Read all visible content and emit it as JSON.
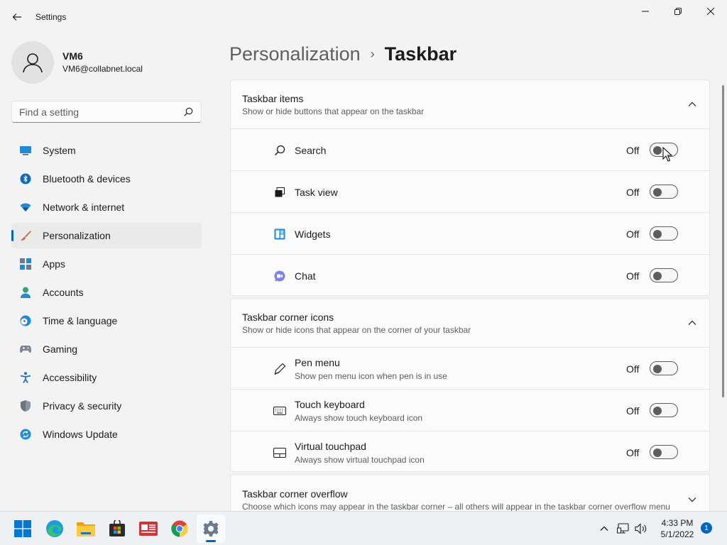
{
  "window": {
    "title": "Settings"
  },
  "profile": {
    "name": "VM6",
    "email": "VM6@collabnet.local"
  },
  "search": {
    "placeholder": "Find a setting"
  },
  "nav": {
    "items": [
      {
        "label": "System",
        "icon": "system-icon"
      },
      {
        "label": "Bluetooth & devices",
        "icon": "bluetooth-icon"
      },
      {
        "label": "Network & internet",
        "icon": "wifi-icon"
      },
      {
        "label": "Personalization",
        "icon": "brush-icon",
        "selected": true
      },
      {
        "label": "Apps",
        "icon": "apps-icon"
      },
      {
        "label": "Accounts",
        "icon": "person-icon"
      },
      {
        "label": "Time & language",
        "icon": "clock-globe-icon"
      },
      {
        "label": "Gaming",
        "icon": "gamepad-icon"
      },
      {
        "label": "Accessibility",
        "icon": "accessibility-icon"
      },
      {
        "label": "Privacy & security",
        "icon": "shield-icon"
      },
      {
        "label": "Windows Update",
        "icon": "update-icon"
      }
    ]
  },
  "breadcrumb": {
    "parent": "Personalization",
    "separator": "›",
    "current": "Taskbar"
  },
  "sections": {
    "items": {
      "title": "Taskbar items",
      "subtitle": "Show or hide buttons that appear on the taskbar",
      "expanded": true,
      "rows": [
        {
          "label": "Search",
          "state": "Off",
          "on": false,
          "icon": "search-icon"
        },
        {
          "label": "Task view",
          "state": "Off",
          "on": false,
          "icon": "task-view-icon"
        },
        {
          "label": "Widgets",
          "state": "Off",
          "on": false,
          "icon": "widgets-icon"
        },
        {
          "label": "Chat",
          "state": "Off",
          "on": false,
          "icon": "chat-icon"
        }
      ]
    },
    "corner_icons": {
      "title": "Taskbar corner icons",
      "subtitle": "Show or hide icons that appear on the corner of your taskbar",
      "expanded": true,
      "rows": [
        {
          "label": "Pen menu",
          "sub": "Show pen menu icon when pen is in use",
          "state": "Off",
          "on": false,
          "icon": "pen-icon"
        },
        {
          "label": "Touch keyboard",
          "sub": "Always show touch keyboard icon",
          "state": "Off",
          "on": false,
          "icon": "keyboard-icon"
        },
        {
          "label": "Virtual touchpad",
          "sub": "Always show virtual touchpad icon",
          "state": "Off",
          "on": false,
          "icon": "touchpad-icon"
        }
      ]
    },
    "overflow": {
      "title": "Taskbar corner overflow",
      "subtitle": "Choose which icons may appear in the taskbar corner – all others will appear in the taskbar corner overflow menu",
      "expanded": false
    }
  },
  "taskbar": {
    "apps": [
      "start-icon",
      "edge-icon",
      "file-explorer-icon",
      "store-icon",
      "news-icon",
      "chrome-icon",
      "settings-icon"
    ],
    "active_app": "settings-icon",
    "tray": [
      "chevron-up-icon",
      "network-icon",
      "volume-icon"
    ],
    "time": "4:33 PM",
    "date": "5/1/2022",
    "notifications": "1"
  },
  "colors": {
    "accent": "#0067c0",
    "background": "#f3f3f3",
    "card": "#fbfbfb"
  }
}
